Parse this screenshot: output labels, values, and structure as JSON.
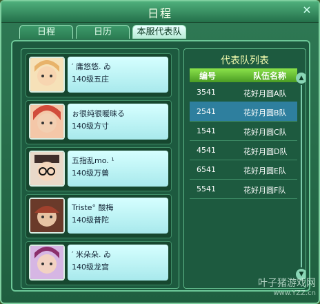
{
  "window": {
    "title": "日程",
    "close_glyph": "✕"
  },
  "tabs": [
    {
      "label": "日程",
      "active": false
    },
    {
      "label": "日历",
      "active": false
    },
    {
      "label": "本服代表队",
      "active": true
    }
  ],
  "members": [
    {
      "name": "′ 庸悠悠. ゐ",
      "level_school": "140级五庄",
      "avatar_color": "#e8b36a"
    },
    {
      "name": "ぉ很纯很暖昧る",
      "level_school": "140级方寸",
      "avatar_color": "#d14b3a"
    },
    {
      "name": "五指乱mo. ¹",
      "level_school": "140级万兽",
      "avatar_color": "#3f2d2a"
    },
    {
      "name": "Triste° 酸梅",
      "level_school": "140级普陀",
      "avatar_color": "#a0412d"
    },
    {
      "name": "′ 米朵朵. ゐ",
      "level_school": "140级龙宫",
      "avatar_color": "#8b2f6c"
    }
  ],
  "team_list": {
    "title": "代表队列表",
    "headers": {
      "id": "编号",
      "name": "队伍名称"
    },
    "rows": [
      {
        "id": "3541",
        "name": "花好月圆A队",
        "selected": false
      },
      {
        "id": "2541",
        "name": "花好月圆B队",
        "selected": true
      },
      {
        "id": "1541",
        "name": "花好月圆C队",
        "selected": false
      },
      {
        "id": "4541",
        "name": "花好月圆D队",
        "selected": false
      },
      {
        "id": "6541",
        "name": "花好月圆E队",
        "selected": false
      },
      {
        "id": "5541",
        "name": "花好月圆F队",
        "selected": false
      }
    ]
  },
  "watermark": {
    "text": "叶子猪游戏网",
    "url": "www.YZZ.cn"
  },
  "colors": {
    "accent": "#7fd0a0",
    "selected_row": "#2e7f9e"
  }
}
